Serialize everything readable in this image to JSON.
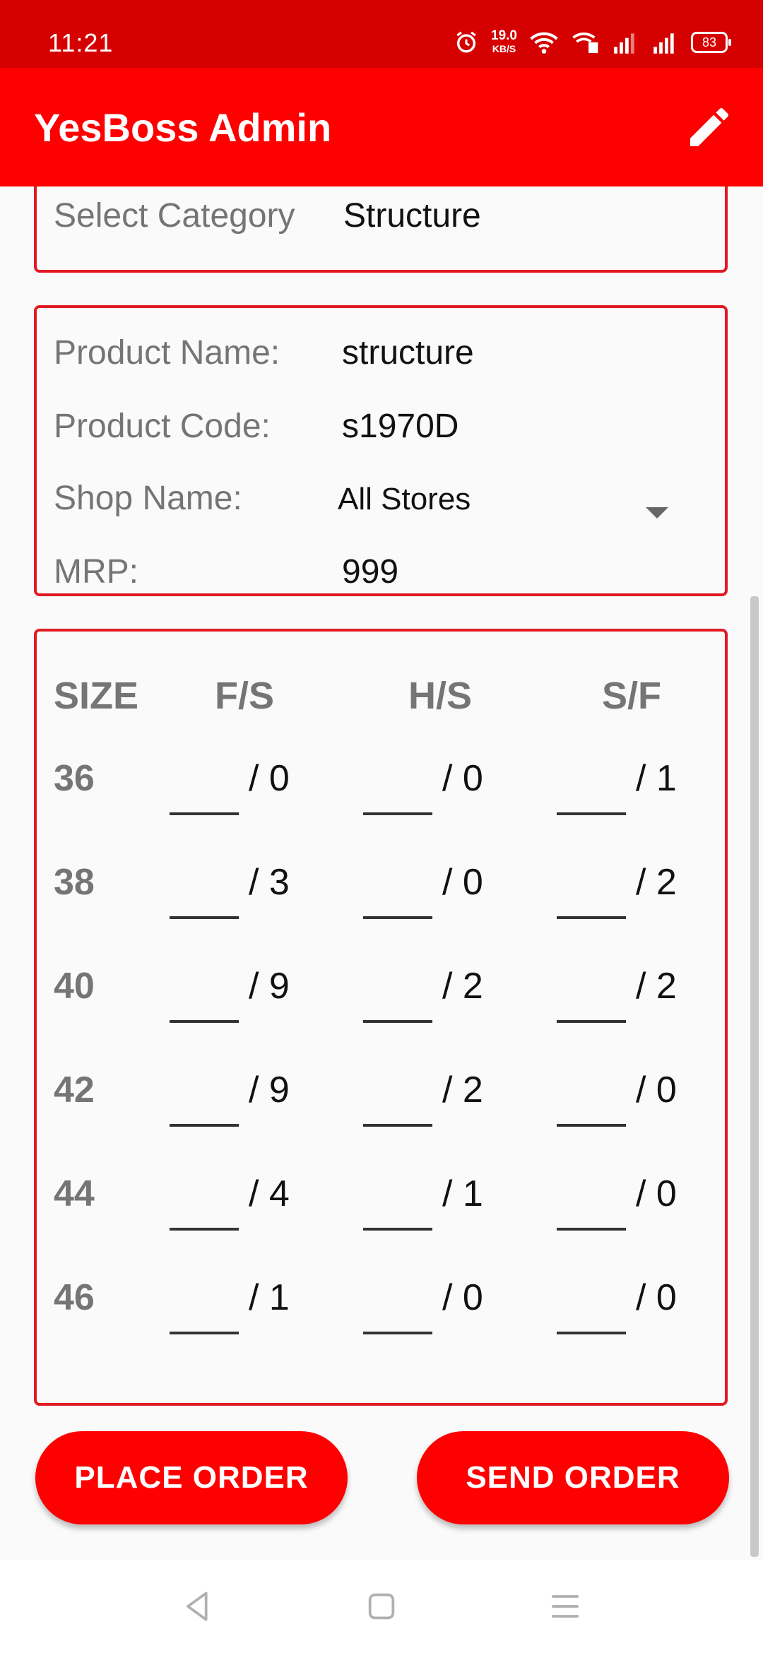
{
  "status_bar": {
    "time": "11:21",
    "net_speed": "19.0",
    "net_unit": "KB/S",
    "battery": "83"
  },
  "app_bar": {
    "title": "YesBoss Admin",
    "edit_icon": "pencil-icon"
  },
  "category": {
    "label": "Select Category",
    "value": "Structure"
  },
  "product": {
    "name_label": "Product Name:",
    "name_value": "structure",
    "code_label": "Product Code:",
    "code_value": "s1970D",
    "shop_label": "Shop Name:",
    "shop_value": "All Stores",
    "mrp_label": "MRP:",
    "mrp_value": "999"
  },
  "table": {
    "headers": [
      "SIZE",
      "F/S",
      "H/S",
      "S/F"
    ],
    "rows": [
      {
        "size": "36",
        "fs": "/ 0",
        "hs": "/ 0",
        "sf": "/ 1"
      },
      {
        "size": "38",
        "fs": "/ 3",
        "hs": "/ 0",
        "sf": "/ 2"
      },
      {
        "size": "40",
        "fs": "/ 9",
        "hs": "/ 2",
        "sf": "/ 2"
      },
      {
        "size": "42",
        "fs": "/ 9",
        "hs": "/ 2",
        "sf": "/ 0"
      },
      {
        "size": "44",
        "fs": "/ 4",
        "hs": "/ 1",
        "sf": "/ 0"
      },
      {
        "size": "46",
        "fs": "/ 1",
        "hs": "/ 0",
        "sf": "/ 0"
      }
    ]
  },
  "buttons": {
    "place_order": "PLACE ORDER",
    "send_order": "SEND ORDER"
  },
  "colors": {
    "status_bar": "#d50000",
    "app_bar": "#ff0000",
    "border": "#e01b22",
    "label": "#757575"
  }
}
